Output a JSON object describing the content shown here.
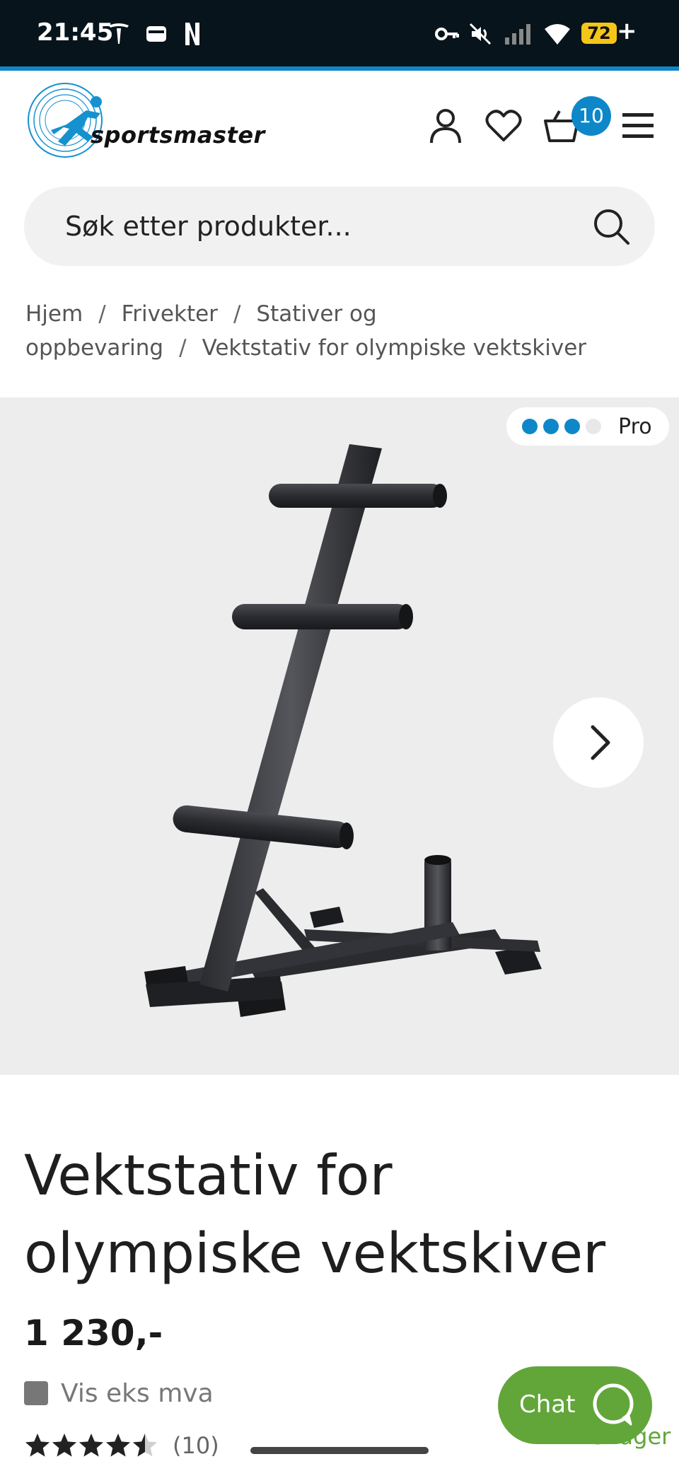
{
  "status_bar": {
    "time": "21:45",
    "battery": "72",
    "icons": [
      "tesla-icon",
      "wallet-icon",
      "netflix-icon",
      "vpn-key-icon",
      "mute-icon",
      "signal-icon",
      "wifi-icon",
      "battery-icon"
    ]
  },
  "header": {
    "logo_text": "sportsmaster",
    "cart_count": "10",
    "icons": [
      "account-icon",
      "heart-icon",
      "basket-icon",
      "menu-icon"
    ]
  },
  "search": {
    "placeholder": "Søk etter produkter..."
  },
  "breadcrumb": {
    "items": [
      "Hjem",
      "Frivekter",
      "Stativer og oppbevaring",
      "Vektstativ for olympiske vektskiver"
    ],
    "separator": "/"
  },
  "gallery": {
    "level_badge": "Pro",
    "level_dots_filled": 3,
    "level_dots_total": 4,
    "accent": "#0e87c9"
  },
  "product": {
    "title": "Vektstativ for olympiske vektskiver",
    "price": "1 230,-",
    "vat_toggle_label": "Vis eks mva",
    "rating_stars": 4.5,
    "rating_max": 5,
    "rating_count": "(10)",
    "obscured_text": "✓ På lager"
  },
  "chat": {
    "label": "Chat",
    "color": "#62a63a"
  }
}
